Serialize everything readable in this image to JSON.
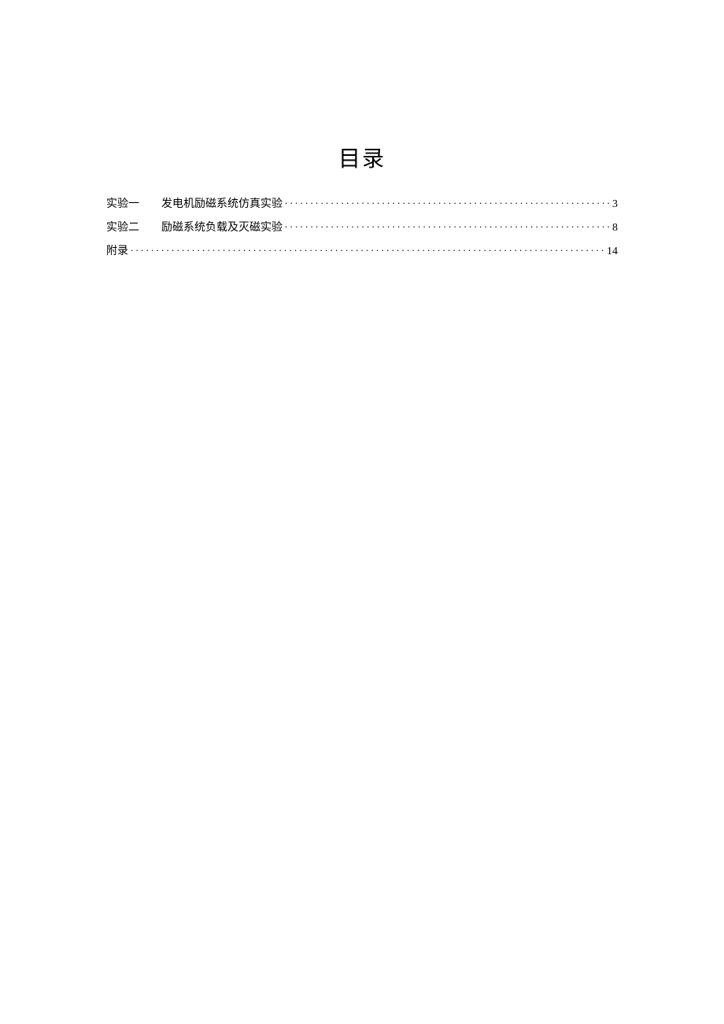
{
  "title": "目录",
  "toc": [
    {
      "label": "实验一",
      "desc": "发电机励磁系统仿真实验",
      "page": "3"
    },
    {
      "label": "实验二",
      "desc": "励磁系统负载及灭磁实验",
      "page": "8"
    },
    {
      "label": "附录",
      "desc": "",
      "page": "14"
    }
  ]
}
